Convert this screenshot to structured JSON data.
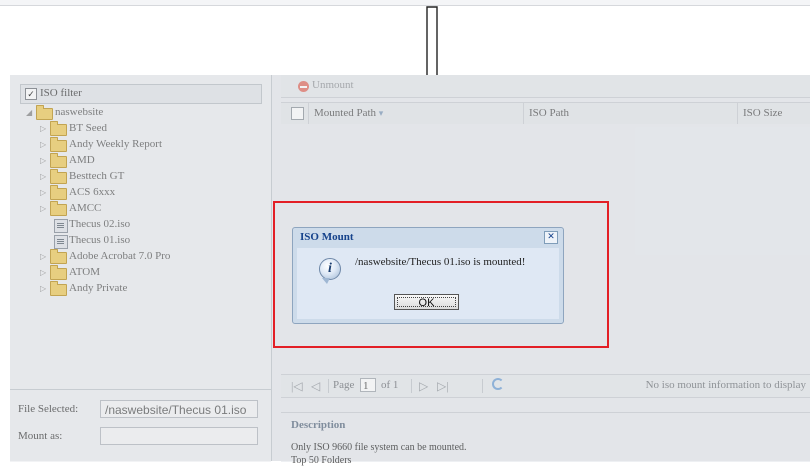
{
  "filter": {
    "label": "ISO filter",
    "checked_glyph": "✓"
  },
  "tree": {
    "expand_open": "◢",
    "expand_closed": "▷",
    "root": "naswebsite",
    "items": [
      "BT Seed",
      "Andy Weekly Report",
      "AMD",
      "Besttech GT",
      "ACS 6xxx",
      "AMCC",
      "Thecus 02.iso",
      "Thecus 01.iso",
      "Adobe Acrobat 7.0 Pro",
      "ATOM",
      "Andy Private"
    ]
  },
  "form": {
    "file_selected_label": "File Selected:",
    "file_selected_value": "/naswebsite/Thecus 01.iso",
    "mount_as_label": "Mount as:",
    "mount_as_value": ""
  },
  "toolbar": {
    "unmount_label": "Unmount"
  },
  "grid": {
    "columns": [
      "Mounted Path",
      "ISO Path",
      "ISO Size"
    ],
    "sort_glyph": "▾"
  },
  "pager": {
    "first": "|◁",
    "prev": "◁",
    "next": "▷",
    "last": "▷|",
    "page_label": "Page",
    "page_value": "1",
    "of_label": "of 1",
    "empty_message": "No iso mount information to display"
  },
  "description": {
    "title": "Description",
    "line1": "Only ISO 9660 file system can be mounted.",
    "line2": "Top 50 Folders"
  },
  "dialog": {
    "title": "ISO Mount",
    "close_glyph": "✕",
    "icon_glyph": "i",
    "message": "/naswebsite/Thecus 01.iso is mounted!",
    "ok_label": "OK"
  },
  "colors": {
    "highlight_border": "#e31f26",
    "dialog_title": "#15428b",
    "folder": "#f3d57c"
  },
  "icons": [
    "checkbox-icon",
    "folder-icon",
    "iso-file-icon",
    "unmount-icon",
    "refresh-icon",
    "info-icon",
    "close-icon",
    "down-arrow-icon"
  ]
}
